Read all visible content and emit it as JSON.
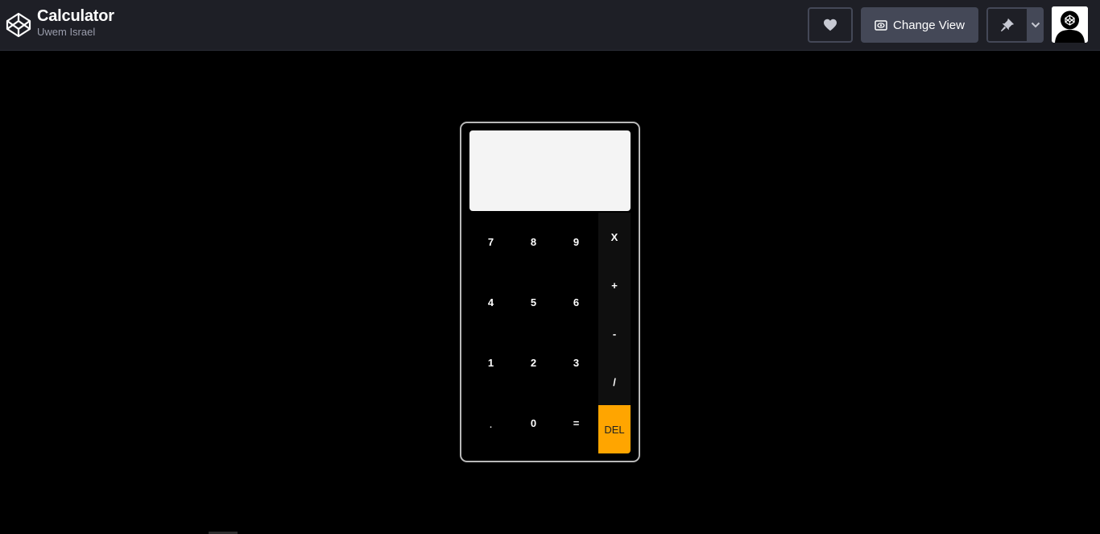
{
  "header": {
    "pen_title": "Calculator",
    "author": "Uwem Israel",
    "change_view_label": "Change View"
  },
  "icons": {
    "logo": "codepen-logo-icon",
    "heart": "heart-icon",
    "change_view": "eye-window-icon",
    "pin": "pin-icon",
    "dropdown": "chevron-down-icon",
    "avatar": "user-avatar-icon"
  },
  "calculator": {
    "display_value": "",
    "keys": {
      "k7": "7",
      "k8": "8",
      "k9": "9",
      "k4": "4",
      "k5": "5",
      "k6": "6",
      "k1": "1",
      "k2": "2",
      "k3": "3",
      "kdot": ".",
      "k0": "0",
      "keq": "="
    },
    "operators": {
      "mult": "X",
      "plus": "+",
      "minus": "-",
      "div": "/",
      "del": "DEL"
    }
  },
  "colors": {
    "header_bg": "#1e1f26",
    "button_bg": "#444857",
    "page_bg": "#000000",
    "display_bg": "#f4f4f4",
    "del_accent": "#ffa500",
    "calc_border": "#b8b8b8"
  }
}
